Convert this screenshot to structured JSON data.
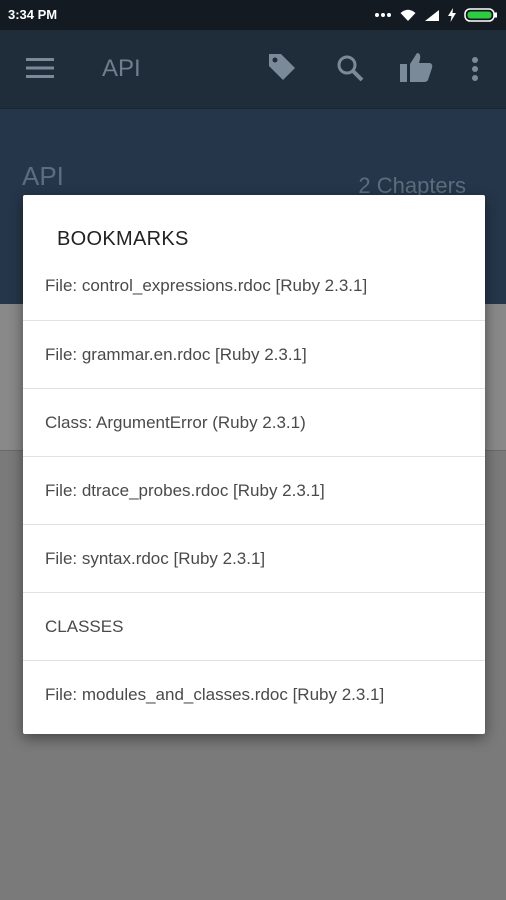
{
  "status_bar": {
    "time": "3:34 PM"
  },
  "app_bar": {
    "title": "API"
  },
  "hero": {
    "title": "API",
    "chapters": "2 Chapters"
  },
  "dialog": {
    "title": "BOOKMARKS",
    "items": [
      "File: control_expressions.rdoc [Ruby 2.3.1]",
      "File: grammar.en.rdoc [Ruby 2.3.1]",
      "Class: ArgumentError (Ruby 2.3.1)",
      "File: dtrace_probes.rdoc [Ruby 2.3.1]",
      "File: syntax.rdoc [Ruby 2.3.1]",
      "CLASSES",
      "File: modules_and_classes.rdoc [Ruby 2.3.1]"
    ]
  },
  "icons": [
    "dots-icon",
    "wifi-icon",
    "signal-icon",
    "charging-icon",
    "battery-icon",
    "menu-icon",
    "tag-icon",
    "search-icon",
    "thumbs-up-icon",
    "more-vert-icon"
  ]
}
